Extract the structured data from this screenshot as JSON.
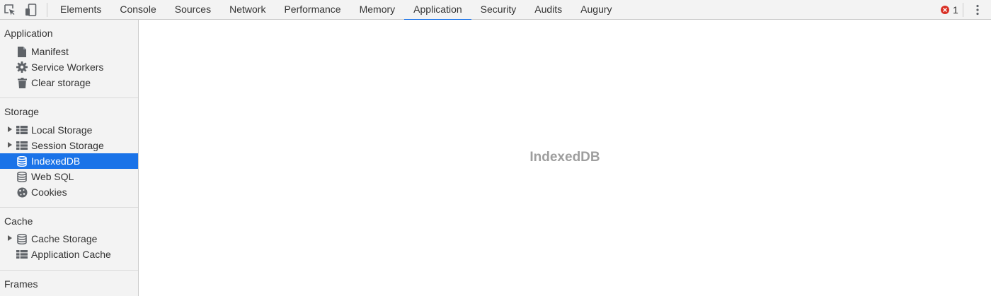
{
  "toolbar": {
    "inspect_icon": "inspect-element-icon",
    "device_icon": "device-toolbar-icon",
    "tabs": [
      {
        "label": "Elements"
      },
      {
        "label": "Console"
      },
      {
        "label": "Sources"
      },
      {
        "label": "Network"
      },
      {
        "label": "Performance"
      },
      {
        "label": "Memory"
      },
      {
        "label": "Application",
        "selected": true
      },
      {
        "label": "Security"
      },
      {
        "label": "Audits"
      },
      {
        "label": "Augury"
      }
    ],
    "error_count": "1",
    "menu_icon": "vertical-dots-icon"
  },
  "sidebar": {
    "application": {
      "title": "Application",
      "items": [
        {
          "label": "Manifest",
          "icon": "document-icon"
        },
        {
          "label": "Service Workers",
          "icon": "gear-icon"
        },
        {
          "label": "Clear storage",
          "icon": "trash-icon"
        }
      ]
    },
    "storage": {
      "title": "Storage",
      "items": [
        {
          "label": "Local Storage",
          "icon": "grid-icon",
          "expandable": true
        },
        {
          "label": "Session Storage",
          "icon": "grid-icon",
          "expandable": true
        },
        {
          "label": "IndexedDB",
          "icon": "database-icon",
          "selected": true
        },
        {
          "label": "Web SQL",
          "icon": "database-icon"
        },
        {
          "label": "Cookies",
          "icon": "cookie-icon"
        }
      ]
    },
    "cache": {
      "title": "Cache",
      "items": [
        {
          "label": "Cache Storage",
          "icon": "database-icon",
          "expandable": true
        },
        {
          "label": "Application Cache",
          "icon": "grid-icon"
        }
      ]
    },
    "frames": {
      "title": "Frames"
    }
  },
  "main": {
    "placeholder_title": "IndexedDB"
  },
  "colors": {
    "accent": "#1a73e8",
    "error": "#d93025",
    "panel_bg": "#f3f3f3",
    "placeholder_text": "#9e9e9e"
  }
}
